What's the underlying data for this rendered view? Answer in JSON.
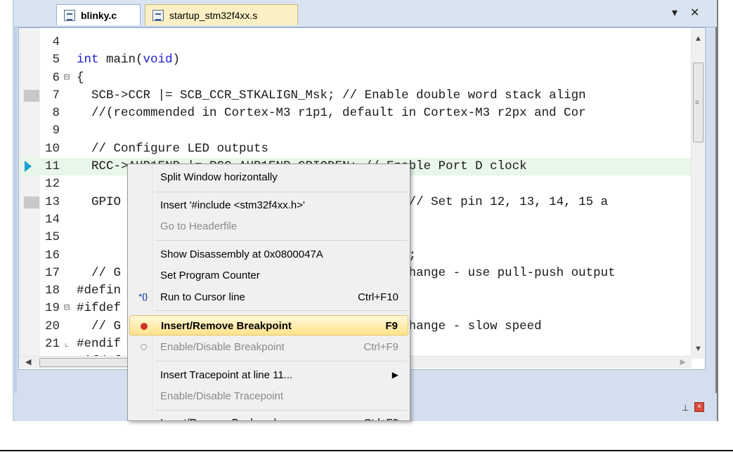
{
  "tabs": [
    {
      "label": "blinky.c",
      "active": true
    },
    {
      "label": "startup_stm32f4xx.s",
      "active": false
    }
  ],
  "tab_controls": {
    "dropdown": "▾",
    "close": "✕"
  },
  "editor": {
    "lines": [
      {
        "num": "4",
        "fold": "",
        "code": "",
        "breakpoint": false,
        "current": false
      },
      {
        "num": "5",
        "fold": "",
        "code": "int main(void)",
        "breakpoint": false,
        "current": false
      },
      {
        "num": "6",
        "fold": "⊟",
        "code": "{",
        "breakpoint": false,
        "current": false
      },
      {
        "num": "7",
        "fold": "",
        "code": "  SCB->CCR |= SCB_CCR_STKALIGN_Msk; // Enable double word stack align",
        "breakpoint": true,
        "current": false
      },
      {
        "num": "8",
        "fold": "",
        "code": "  //(recommended in Cortex-M3 r1p1, default in Cortex-M3 r2px and Cor",
        "breakpoint": false,
        "current": false
      },
      {
        "num": "9",
        "fold": "",
        "code": "",
        "breakpoint": false,
        "current": false
      },
      {
        "num": "10",
        "fold": "",
        "code": "  // Configure LED outputs",
        "breakpoint": false,
        "current": false
      },
      {
        "num": "11",
        "fold": "",
        "code": "  RCC->AHB1ENR |= RCC_AHB1ENR_GPIODEN; // Enable Port D clock",
        "breakpoint": false,
        "current": true
      },
      {
        "num": "12",
        "fold": "",
        "code": "",
        "breakpoint": false,
        "current": false
      },
      {
        "num": "13",
        "fold": "",
        "code": "  GPIO                                   0 | // Set pin 12, 13, 14, 15 a",
        "breakpoint": true,
        "current": false
      },
      {
        "num": "14",
        "fold": "",
        "code": "                                         0 |",
        "breakpoint": false,
        "current": false
      },
      {
        "num": "15",
        "fold": "",
        "code": "                                         0 |",
        "breakpoint": false,
        "current": false
      },
      {
        "num": "16",
        "fold": "",
        "code": "                                         0 ) ;",
        "breakpoint": false,
        "current": false
      },
      {
        "num": "17",
        "fold": "",
        "code": "  // G                                    o change - use pull-push output",
        "breakpoint": false,
        "current": false
      },
      {
        "num": "18",
        "fold": "",
        "code": "#defin",
        "breakpoint": false,
        "current": false
      },
      {
        "num": "19",
        "fold": "⊟",
        "code": "#ifdef",
        "breakpoint": false,
        "current": false
      },
      {
        "num": "20",
        "fold": "",
        "code": "  // G                                    o change - slow speed",
        "breakpoint": false,
        "current": false
      },
      {
        "num": "21",
        "fold": "⌞",
        "code": "#endif",
        "breakpoint": false,
        "current": false
      },
      {
        "num": "22",
        "fold": "⊟",
        "code": "#ifdef",
        "breakpoint": false,
        "current": false
      }
    ]
  },
  "context_menu": {
    "items": [
      {
        "label": "Split Window horizontally",
        "shortcut": "",
        "disabled": false,
        "icon": ""
      },
      {
        "label": "Insert '#include <stm32f4xx.h>'",
        "shortcut": "",
        "disabled": false,
        "icon": ""
      },
      {
        "label": "Go to Headerfile",
        "shortcut": "",
        "disabled": true,
        "icon": ""
      },
      {
        "label": "Show Disassembly at 0x0800047A",
        "shortcut": "",
        "disabled": false,
        "icon": ""
      },
      {
        "label": "Set Program Counter",
        "shortcut": "",
        "disabled": false,
        "icon": ""
      },
      {
        "label": "Run to Cursor line",
        "shortcut": "Ctrl+F10",
        "disabled": false,
        "icon": "run-to-cursor-icon"
      },
      {
        "label": "Insert/Remove Breakpoint",
        "shortcut": "F9",
        "disabled": false,
        "icon": "breakpoint-icon",
        "highlighted": true
      },
      {
        "label": "Enable/Disable Breakpoint",
        "shortcut": "Ctrl+F9",
        "disabled": true,
        "icon": "breakpoint-disabled-icon"
      },
      {
        "label": "Insert Tracepoint at line 11...",
        "shortcut": "",
        "disabled": false,
        "icon": "",
        "submenu": true
      },
      {
        "label": "Enable/Disable Tracepoint",
        "shortcut": "",
        "disabled": true,
        "icon": ""
      },
      {
        "label": "Insert/Remove Bookmark",
        "shortcut": "Ctrl+F2",
        "disabled": false,
        "icon": "bookmark-icon"
      }
    ]
  },
  "colors": {
    "current_line": "#e8f7e8",
    "highlight_item": "#ffe38a",
    "breakpoint": "#d0312d",
    "arrow": "#1a9fd8"
  }
}
